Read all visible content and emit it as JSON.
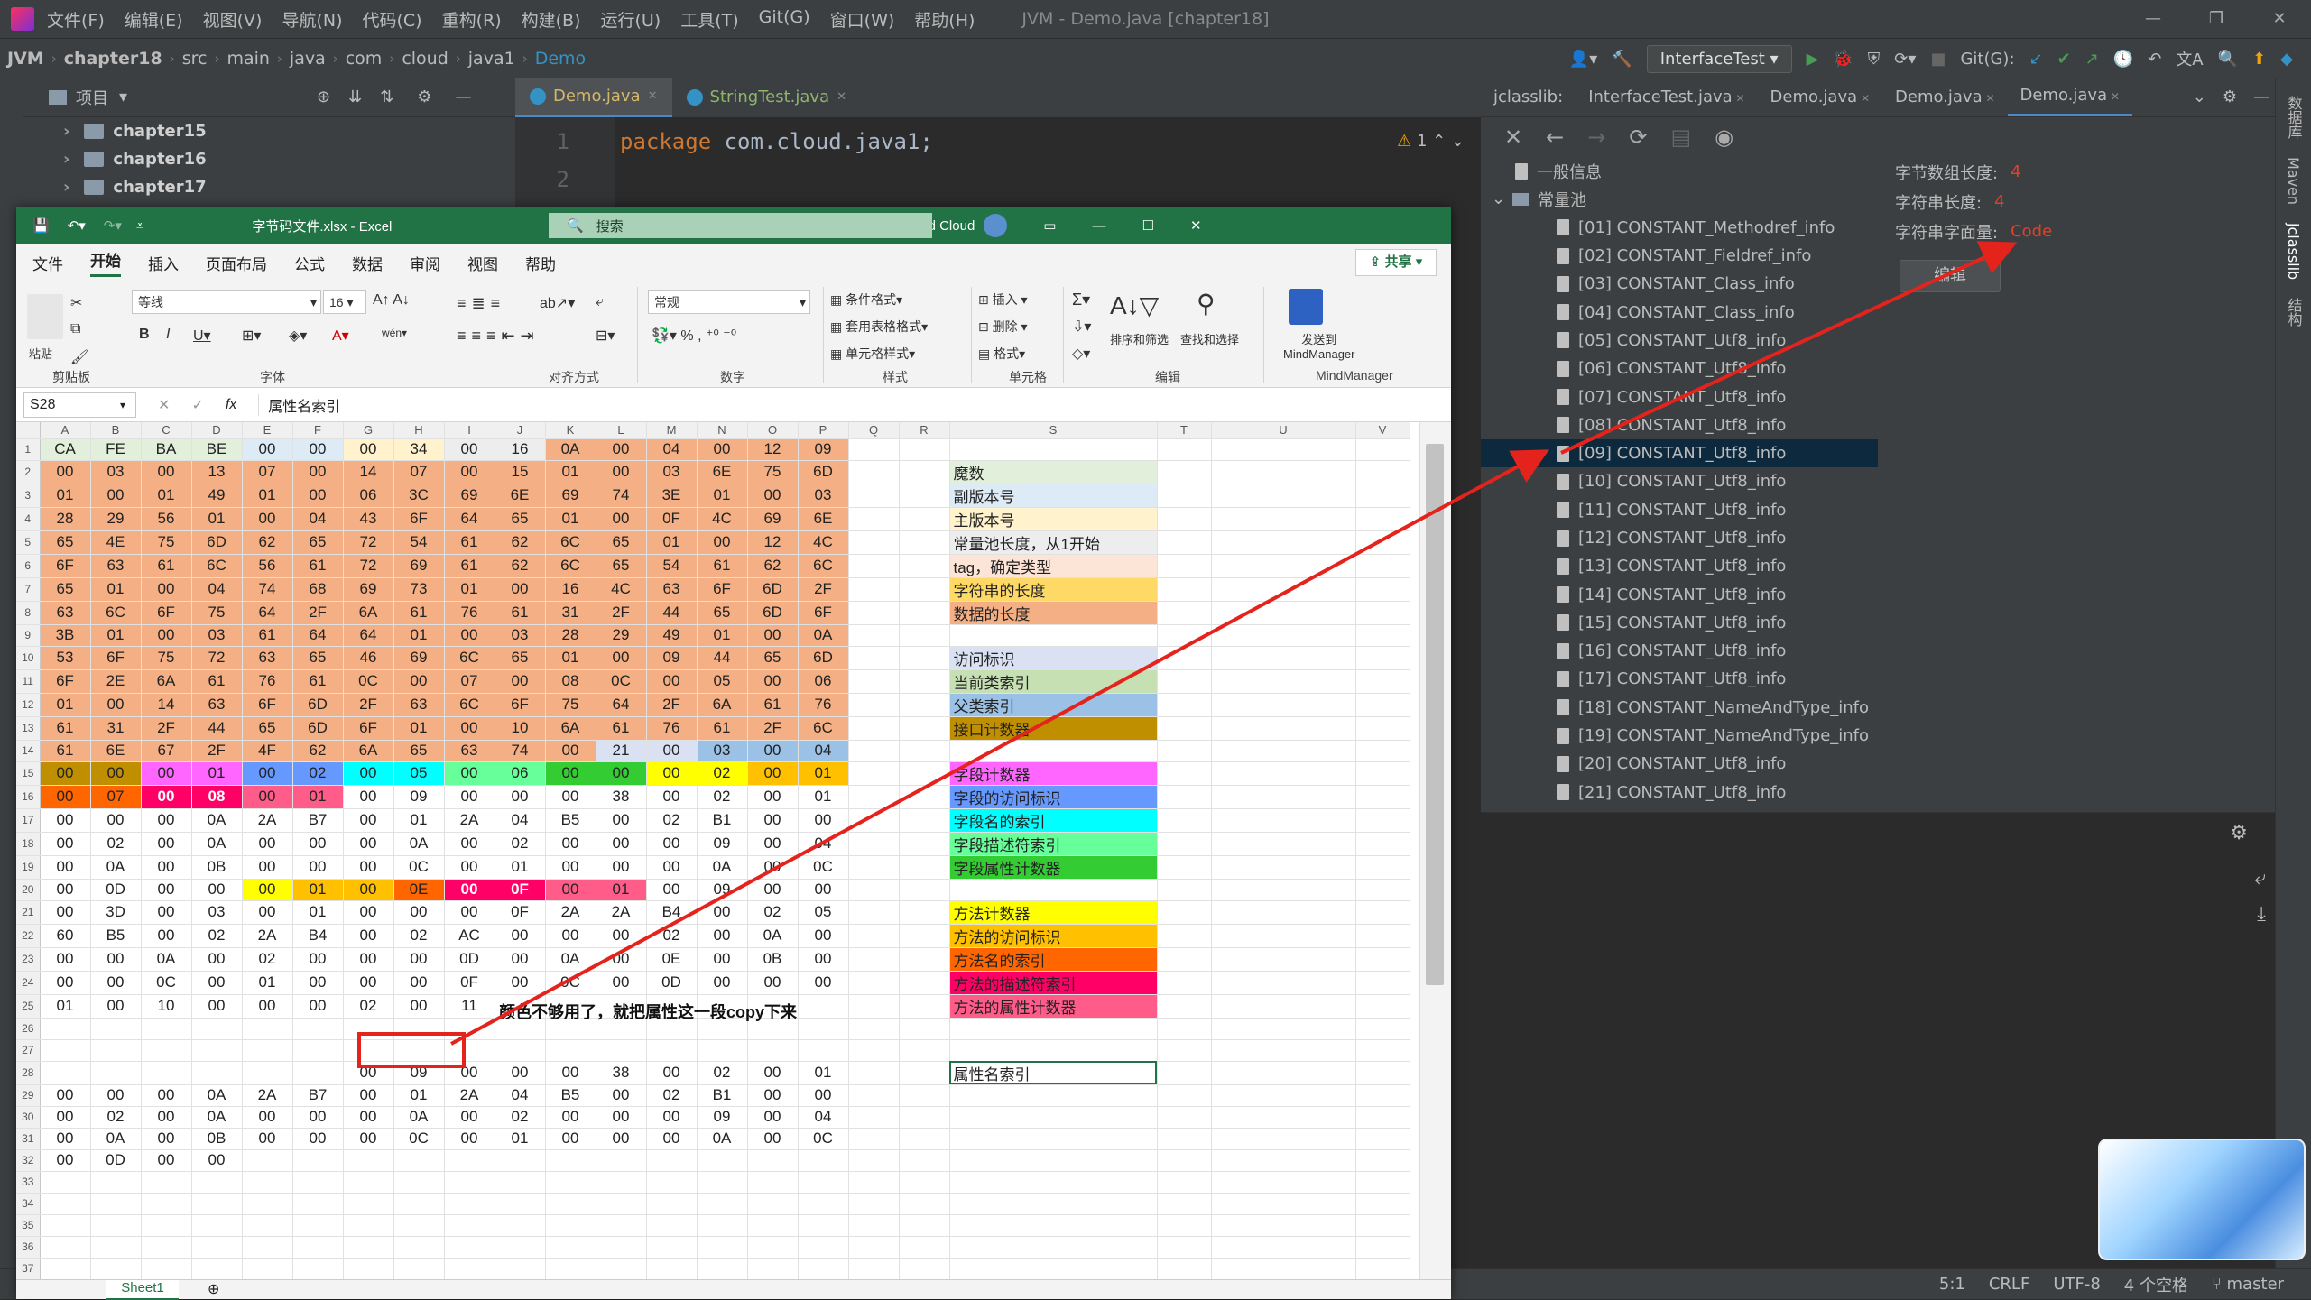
{
  "menubar": {
    "items": [
      "文件(F)",
      "编辑(E)",
      "视图(V)",
      "导航(N)",
      "代码(C)",
      "重构(R)",
      "构建(B)",
      "运行(U)",
      "工具(T)",
      "Git(G)",
      "窗口(W)",
      "帮助(H)"
    ],
    "title": "JVM - Demo.java [chapter18]"
  },
  "nav": {
    "crumbs": [
      "JVM",
      "chapter18",
      "src",
      "main",
      "java",
      "com",
      "cloud",
      "java1",
      "Demo"
    ],
    "run_config": "InterfaceTest",
    "git_label": "Git(G):"
  },
  "project": {
    "header": "项目",
    "nodes": [
      "chapter15",
      "chapter16",
      "chapter17"
    ]
  },
  "editor": {
    "tabs": [
      "Demo.java",
      "StringTest.java"
    ],
    "line_numbers": [
      "1",
      "2"
    ],
    "line1_kw": "package",
    "line1_rest": " com.cloud.java1;",
    "warning_count": "1"
  },
  "jclasslib": {
    "tabs": [
      "jclasslib:",
      "InterfaceTest.java",
      "Demo.java",
      "Demo.java",
      "Demo.java"
    ],
    "tree_general": "一般信息",
    "tree_pool": "常量池",
    "entries": [
      "[01] CONSTANT_Methodref_info",
      "[02] CONSTANT_Fieldref_info",
      "[03] CONSTANT_Class_info",
      "[04] CONSTANT_Class_info",
      "[05] CONSTANT_Utf8_info",
      "[06] CONSTANT_Utf8_info",
      "[07] CONSTANT_Utf8_info",
      "[08] CONSTANT_Utf8_info",
      "[09] CONSTANT_Utf8_info",
      "[10] CONSTANT_Utf8_info",
      "[11] CONSTANT_Utf8_info",
      "[12] CONSTANT_Utf8_info",
      "[13] CONSTANT_Utf8_info",
      "[14] CONSTANT_Utf8_info",
      "[15] CONSTANT_Utf8_info",
      "[16] CONSTANT_Utf8_info",
      "[17] CONSTANT_Utf8_info",
      "[18] CONSTANT_NameAndType_info",
      "[19] CONSTANT_NameAndType_info",
      "[20] CONSTANT_Utf8_info",
      "[21] CONSTANT_Utf8_info"
    ],
    "selected_index": 8,
    "info": {
      "bytes_len_label": "字节数组长度:",
      "bytes_len": "4",
      "str_len_label": "字符串长度:",
      "str_len": "4",
      "literal_label": "字符串字面量:",
      "literal": "Code",
      "edit_button": "编辑"
    },
    "right_strip": [
      "数据库",
      "Maven",
      "jclasslib",
      "结构"
    ]
  },
  "status": {
    "pos": "5:1",
    "eol": "CRLF",
    "encoding": "UTF-8",
    "indent": "4 个空格",
    "branch": "master"
  },
  "excel": {
    "filename": "字节码文件.xlsx - Excel",
    "search": "搜索",
    "user": "Byond Cloud",
    "menu": [
      "文件",
      "开始",
      "插入",
      "页面布局",
      "公式",
      "数据",
      "审阅",
      "视图",
      "帮助"
    ],
    "share": "共享",
    "font": "等线",
    "font_size": "16",
    "number_format": "常规",
    "ribbon_groups": [
      "剪贴板",
      "字体",
      "对齐方式",
      "数字",
      "样式",
      "单元格",
      "编辑",
      "MindManager"
    ],
    "ribbon_labels": {
      "cond": "条件格式",
      "table": "套用表格格式",
      "cellstyle": "单元格样式",
      "insert": "插入",
      "delete": "删除",
      "format": "格式",
      "sort": "排序和筛选",
      "find": "查找和选择",
      "send": "发送到",
      "mm": "MindManager",
      "paste": "粘贴"
    },
    "namebox": "S28",
    "formula": "属性名索引",
    "columns": [
      "A",
      "B",
      "C",
      "D",
      "E",
      "F",
      "G",
      "H",
      "I",
      "J",
      "K",
      "L",
      "M",
      "N",
      "O",
      "P",
      "Q",
      "R",
      "S",
      "T",
      "U",
      "V"
    ],
    "rows": [
      [
        "CA",
        "FE",
        "BA",
        "BE",
        "00",
        "00",
        "00",
        "34",
        "00",
        "16",
        "0A",
        "00",
        "04",
        "00",
        "12",
        "09"
      ],
      [
        "00",
        "03",
        "00",
        "13",
        "07",
        "00",
        "14",
        "07",
        "00",
        "15",
        "01",
        "00",
        "03",
        "6E",
        "75",
        "6D"
      ],
      [
        "01",
        "00",
        "01",
        "49",
        "01",
        "00",
        "06",
        "3C",
        "69",
        "6E",
        "69",
        "74",
        "3E",
        "01",
        "00",
        "03"
      ],
      [
        "28",
        "29",
        "56",
        "01",
        "00",
        "04",
        "43",
        "6F",
        "64",
        "65",
        "01",
        "00",
        "0F",
        "4C",
        "69",
        "6E"
      ],
      [
        "65",
        "4E",
        "75",
        "6D",
        "62",
        "65",
        "72",
        "54",
        "61",
        "62",
        "6C",
        "65",
        "01",
        "00",
        "12",
        "4C"
      ],
      [
        "6F",
        "63",
        "61",
        "6C",
        "56",
        "61",
        "72",
        "69",
        "61",
        "62",
        "6C",
        "65",
        "54",
        "61",
        "62",
        "6C"
      ],
      [
        "65",
        "01",
        "00",
        "04",
        "74",
        "68",
        "69",
        "73",
        "01",
        "00",
        "16",
        "4C",
        "63",
        "6F",
        "6D",
        "2F"
      ],
      [
        "63",
        "6C",
        "6F",
        "75",
        "64",
        "2F",
        "6A",
        "61",
        "76",
        "61",
        "31",
        "2F",
        "44",
        "65",
        "6D",
        "6F"
      ],
      [
        "3B",
        "01",
        "00",
        "03",
        "61",
        "64",
        "64",
        "01",
        "00",
        "03",
        "28",
        "29",
        "49",
        "01",
        "00",
        "0A"
      ],
      [
        "53",
        "6F",
        "75",
        "72",
        "63",
        "65",
        "46",
        "69",
        "6C",
        "65",
        "01",
        "00",
        "09",
        "44",
        "65",
        "6D"
      ],
      [
        "6F",
        "2E",
        "6A",
        "61",
        "76",
        "61",
        "0C",
        "00",
        "07",
        "00",
        "08",
        "0C",
        "00",
        "05",
        "00",
        "06"
      ],
      [
        "01",
        "00",
        "14",
        "63",
        "6F",
        "6D",
        "2F",
        "63",
        "6C",
        "6F",
        "75",
        "64",
        "2F",
        "6A",
        "61",
        "76"
      ],
      [
        "61",
        "31",
        "2F",
        "44",
        "65",
        "6D",
        "6F",
        "01",
        "00",
        "10",
        "6A",
        "61",
        "76",
        "61",
        "2F",
        "6C"
      ],
      [
        "61",
        "6E",
        "67",
        "2F",
        "4F",
        "62",
        "6A",
        "65",
        "63",
        "74",
        "00",
        "21",
        "00",
        "03",
        "00",
        "04"
      ],
      [
        "00",
        "00",
        "00",
        "01",
        "00",
        "02",
        "00",
        "05",
        "00",
        "06",
        "00",
        "00",
        "00",
        "02",
        "00",
        "01"
      ],
      [
        "00",
        "07",
        "00",
        "08",
        "00",
        "01",
        "00",
        "09",
        "00",
        "00",
        "00",
        "38",
        "00",
        "02",
        "00",
        "01"
      ],
      [
        "00",
        "00",
        "00",
        "0A",
        "2A",
        "B7",
        "00",
        "01",
        "2A",
        "04",
        "B5",
        "00",
        "02",
        "B1",
        "00",
        "00"
      ],
      [
        "00",
        "02",
        "00",
        "0A",
        "00",
        "00",
        "00",
        "0A",
        "00",
        "02",
        "00",
        "00",
        "00",
        "09",
        "00",
        "04"
      ],
      [
        "00",
        "0A",
        "00",
        "0B",
        "00",
        "00",
        "00",
        "0C",
        "00",
        "01",
        "00",
        "00",
        "00",
        "0A",
        "00",
        "0C"
      ],
      [
        "00",
        "0D",
        "00",
        "00",
        "00",
        "01",
        "00",
        "0E",
        "00",
        "0F",
        "00",
        "01",
        "00",
        "09",
        "00",
        "00"
      ],
      [
        "00",
        "3D",
        "00",
        "03",
        "00",
        "01",
        "00",
        "00",
        "00",
        "0F",
        "2A",
        "2A",
        "B4",
        "00",
        "02",
        "05"
      ],
      [
        "60",
        "B5",
        "00",
        "02",
        "2A",
        "B4",
        "00",
        "02",
        "AC",
        "00",
        "00",
        "00",
        "02",
        "00",
        "0A",
        "00"
      ],
      [
        "00",
        "00",
        "0A",
        "00",
        "02",
        "00",
        "00",
        "00",
        "0D",
        "00",
        "0A",
        "00",
        "0E",
        "00",
        "0B",
        "00"
      ],
      [
        "00",
        "00",
        "0C",
        "00",
        "01",
        "00",
        "00",
        "00",
        "0F",
        "00",
        "0C",
        "00",
        "0D",
        "00",
        "00",
        "00"
      ],
      [
        "01",
        "00",
        "10",
        "00",
        "00",
        "00",
        "02",
        "00",
        "11",
        "",
        "",
        "",
        "",
        "",
        "",
        ""
      ],
      [
        "",
        "",
        "",
        "",
        "",
        "",
        "",
        "",
        "",
        "",
        "",
        "",
        "",
        "",
        "",
        ""
      ],
      [
        "",
        "",
        "",
        "",
        "",
        "",
        "",
        "",
        "",
        "",
        "",
        "",
        "",
        "",
        "",
        ""
      ],
      [
        "",
        "",
        "",
        "",
        "",
        "",
        "00",
        "09",
        "00",
        "00",
        "00",
        "38",
        "00",
        "02",
        "00",
        "01"
      ],
      [
        "00",
        "00",
        "00",
        "0A",
        "2A",
        "B7",
        "00",
        "01",
        "2A",
        "04",
        "B5",
        "00",
        "02",
        "B1",
        "00",
        "00"
      ],
      [
        "00",
        "02",
        "00",
        "0A",
        "00",
        "00",
        "00",
        "0A",
        "00",
        "02",
        "00",
        "00",
        "00",
        "09",
        "00",
        "04"
      ],
      [
        "00",
        "0A",
        "00",
        "0B",
        "00",
        "00",
        "00",
        "0C",
        "00",
        "01",
        "00",
        "00",
        "00",
        "0A",
        "00",
        "0C"
      ],
      [
        "00",
        "0D",
        "00",
        "00",
        "",
        "",
        "",
        "",
        "",
        "",
        "",
        "",
        "",
        "",
        "",
        ""
      ]
    ],
    "legend": [
      {
        "row": 2,
        "text": "魔数",
        "color": "#e2efda"
      },
      {
        "row": 3,
        "text": "副版本号",
        "color": "#ddebf7"
      },
      {
        "row": 4,
        "text": "主版本号",
        "color": "#fff2cc"
      },
      {
        "row": 5,
        "text": "常量池长度，从1开始",
        "color": "#ededed"
      },
      {
        "row": 6,
        "text": "tag，确定类型",
        "color": "#fce4d6"
      },
      {
        "row": 7,
        "text": "字符串的长度",
        "color": "#ffd966"
      },
      {
        "row": 8,
        "text": "数据的长度",
        "color": "#f4b084"
      },
      {
        "row": 10,
        "text": "访问标识",
        "color": "#d9e1f2"
      },
      {
        "row": 11,
        "text": "当前类索引",
        "color": "#c6e0b4"
      },
      {
        "row": 12,
        "text": "父类索引",
        "color": "#9bc2e6"
      },
      {
        "row": 13,
        "text": "接口计数器",
        "color": "#bf8f00"
      },
      {
        "row": 15,
        "text": "字段计数器",
        "color": "#ff66ff"
      },
      {
        "row": 16,
        "text": "字段的访问标识",
        "color": "#6699ff"
      },
      {
        "row": 17,
        "text": "字段名的索引",
        "color": "#00ffff"
      },
      {
        "row": 18,
        "text": "字段描述符索引",
        "color": "#66ff99"
      },
      {
        "row": 19,
        "text": "字段属性计数器",
        "color": "#33cc33"
      },
      {
        "row": 21,
        "text": "方法计数器",
        "color": "#ffff00"
      },
      {
        "row": 22,
        "text": "方法的访问标识",
        "color": "#ffc000"
      },
      {
        "row": 23,
        "text": "方法名的索引",
        "color": "#ff6600"
      },
      {
        "row": 24,
        "text": "方法的描述符索引",
        "color": "#ff0066"
      },
      {
        "row": 25,
        "text": "方法的属性计数器",
        "color": "#ff5c8a"
      },
      {
        "row": 28,
        "text": "属性名索引",
        "color": "#ffffff"
      }
    ],
    "note": "颜色不够用了，就把属性这一段copy下来",
    "sheet": "Sheet1"
  },
  "colors": {
    "accent_red": "#e5231d",
    "excel_green": "#217346",
    "ide_bg": "#2b2b2b",
    "ide_panel": "#3c3f41"
  }
}
